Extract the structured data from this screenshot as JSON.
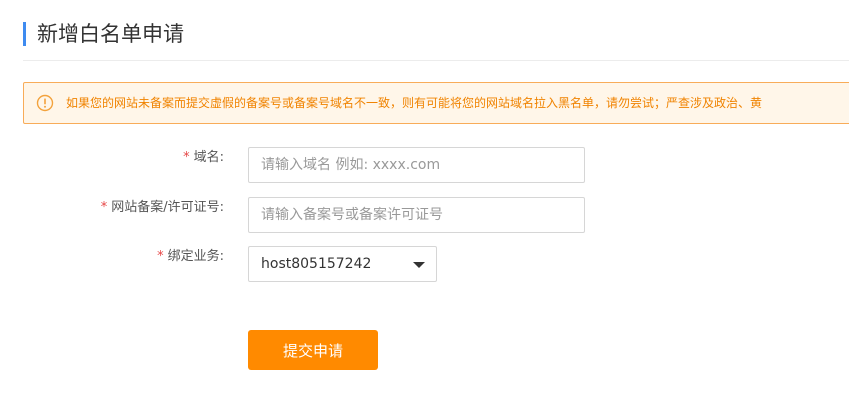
{
  "page": {
    "title": "新增白名单申请"
  },
  "notice": {
    "icon": "warning-circle-icon",
    "text": "如果您的网站未备案而提交虚假的备案号或备案号域名不一致，则有可能将您的网站域名拉入黑名单，请勿尝试；严查涉及政治、黄"
  },
  "form": {
    "required_mark": "*",
    "domain": {
      "label": "域名:",
      "placeholder": "请输入域名 例如: xxxx.com",
      "value": ""
    },
    "icp": {
      "label": "网站备案/许可证号:",
      "placeholder": "请输入备案号或备案许可证号",
      "value": ""
    },
    "service": {
      "label": "绑定业务:",
      "selected": "host805157242"
    },
    "submit_label": "提交申请"
  },
  "colors": {
    "accent": "#ff8a00",
    "title_bar": "#3e8bf0",
    "notice_text": "#f08300",
    "notice_bg": "#fff6e9",
    "notice_border": "#f8ac59",
    "required": "#e64545"
  }
}
